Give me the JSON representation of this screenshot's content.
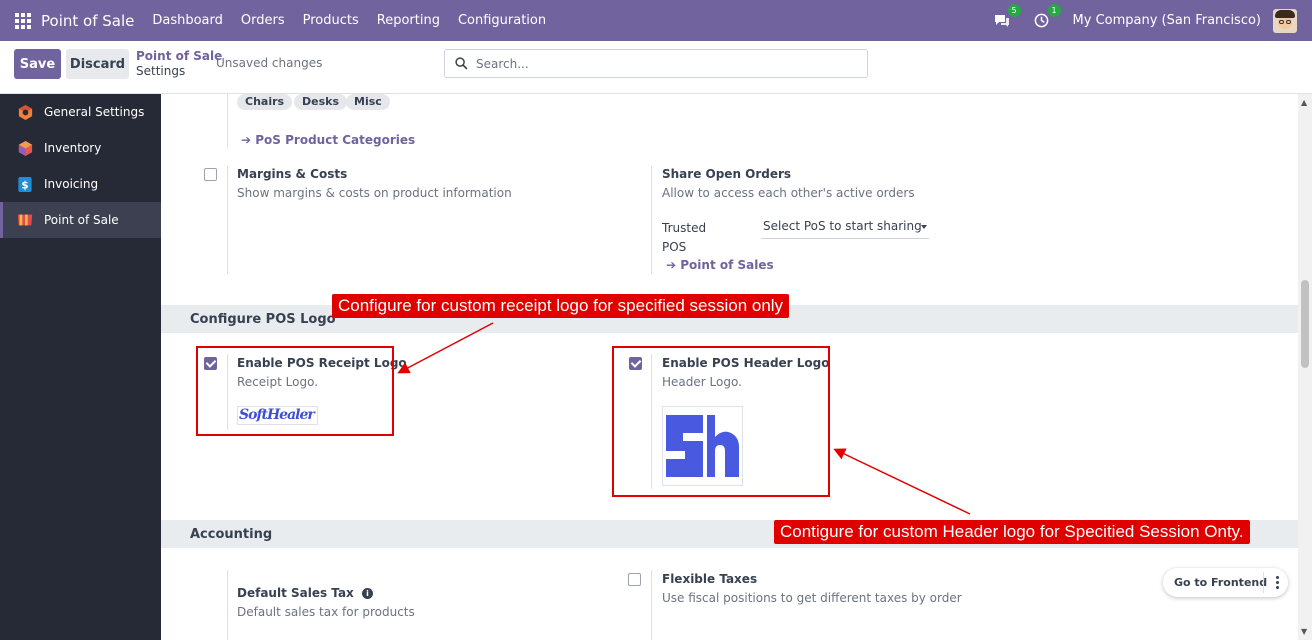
{
  "topbar": {
    "brand": "Point of Sale",
    "menu": [
      "Dashboard",
      "Orders",
      "Products",
      "Reporting",
      "Configuration"
    ],
    "messages_badge": "5",
    "activity_badge": "1",
    "company": "My Company (San Francisco)"
  },
  "control": {
    "save_label": "Save",
    "discard_label": "Discard",
    "breadcrumb_parent": "Point of Sale",
    "breadcrumb_current": "Settings",
    "status": "Unsaved changes",
    "search_placeholder": "Search..."
  },
  "sidebar": {
    "items": [
      {
        "label": "General Settings"
      },
      {
        "label": "Inventory"
      },
      {
        "label": "Invoicing"
      },
      {
        "label": "Point of Sale"
      }
    ]
  },
  "content": {
    "tags": [
      "Chairs",
      "Desks",
      "Misc"
    ],
    "pos_categories_link": "PoS Product Categories",
    "margins": {
      "title": "Margins & Costs",
      "desc": "Show margins & costs on product information",
      "checked": false
    },
    "share": {
      "title": "Share Open Orders",
      "desc": "Allow to access each other's active orders",
      "trusted_label_1": "Trusted",
      "trusted_label_2": "POS",
      "select_placeholder": "Select PoS to start sharing",
      "link": "Point of Sales"
    },
    "logo_section": "Configure POS Logo",
    "receipt": {
      "title": "Enable POS Receipt Logo",
      "desc": "Receipt Logo.",
      "checked": true,
      "logo_text": "SoftHealer"
    },
    "header": {
      "title": "Enable POS Header Logo",
      "desc": "Header Logo.",
      "checked": true
    },
    "accounting_section": "Accounting",
    "sales_tax": {
      "title": "Default Sales Tax",
      "desc": "Default sales tax for products"
    },
    "flexible": {
      "title": "Flexible Taxes",
      "desc": "Use fiscal positions to get different taxes by order",
      "checked": false
    }
  },
  "annotations": {
    "receipt_callout": "Configure for custom receipt logo for specified session only",
    "header_callout": "Contigure for custom Header logo for Specitied Session Onty."
  },
  "frontend_button": "Go to Frontend",
  "colors": {
    "primary": "#71639e",
    "sidebar": "#262a36",
    "annotation": "#e00000"
  }
}
